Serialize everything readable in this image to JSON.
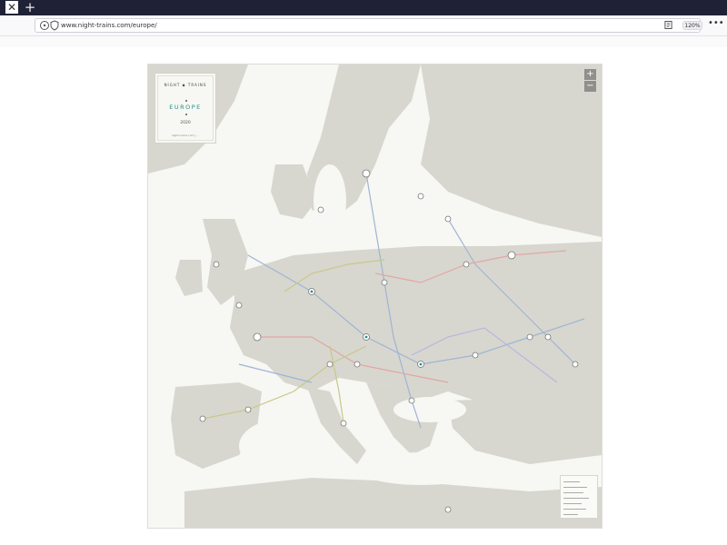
{
  "browser": {
    "tab_close_glyph": "✕",
    "new_tab_glyph": "+",
    "url": "www.night-trains.com/europe/",
    "zoom_level": "120%",
    "menu_glyph": "•••"
  },
  "map": {
    "brand": "NIGHT  ◆  TRAINS",
    "title": "EUROPE",
    "year": "2020",
    "footer": "night-trains.com  |  ...",
    "zoom_in": "+",
    "zoom_out": "−",
    "colors": {
      "sea": "#f7f7f3",
      "land": "#d7d7cf",
      "route_blue": "#9fb4d6",
      "route_red": "#e3a6a6",
      "route_olive": "#c8c88a",
      "station": "#ffffff",
      "accent_teal": "#2e8b8b"
    }
  }
}
